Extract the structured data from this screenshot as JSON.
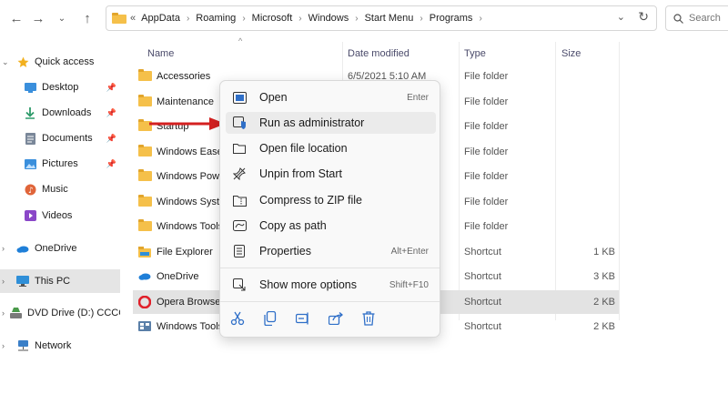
{
  "address": {
    "overflow": "«",
    "crumbs": [
      "AppData",
      "Roaming",
      "Microsoft",
      "Windows",
      "Start Menu",
      "Programs"
    ]
  },
  "search": {
    "placeholder": "Search"
  },
  "sidebar": {
    "items": [
      {
        "label": "Quick access",
        "icon": "star-icon",
        "color": "#f2b01e"
      },
      {
        "label": "Desktop",
        "icon": "desktop-icon",
        "color": "#3a8fdc"
      },
      {
        "label": "Downloads",
        "icon": "download-icon",
        "color": "#2e9a6a"
      },
      {
        "label": "Documents",
        "icon": "documents-icon",
        "color": "#7a8799"
      },
      {
        "label": "Pictures",
        "icon": "pictures-icon",
        "color": "#3a8fdc"
      },
      {
        "label": "Music",
        "icon": "music-icon",
        "color": "#e0653a"
      },
      {
        "label": "Videos",
        "icon": "videos-icon",
        "color": "#8a47c8"
      },
      {
        "label": "OneDrive",
        "icon": "onedrive-icon",
        "color": "#1f7fd8"
      },
      {
        "label": "This PC",
        "icon": "computer-icon",
        "color": "#2f8fd8"
      },
      {
        "label": "DVD Drive (D:) CCCO",
        "icon": "dvd-icon",
        "color": "#4a9a4a"
      },
      {
        "label": "Network",
        "icon": "network-icon",
        "color": "#3a7fc8"
      }
    ]
  },
  "columns": {
    "name": "Name",
    "date": "Date modified",
    "type": "Type",
    "size": "Size"
  },
  "files": [
    {
      "name": "Accessories",
      "date": "6/5/2021 5:10 AM",
      "type": "File folder",
      "size": "",
      "icon": "folder-icon"
    },
    {
      "name": "Maintenance",
      "date": "",
      "type": "File folder",
      "size": "",
      "icon": "folder-icon"
    },
    {
      "name": "Startup",
      "date": "",
      "type": "File folder",
      "size": "",
      "icon": "folder-icon"
    },
    {
      "name": "Windows Ease o",
      "date": "",
      "type": "File folder",
      "size": "",
      "icon": "folder-icon"
    },
    {
      "name": "Windows Powe",
      "date": "",
      "type": "File folder",
      "size": "",
      "icon": "folder-icon"
    },
    {
      "name": "Windows Syste",
      "date": "",
      "type": "File folder",
      "size": "",
      "icon": "folder-icon"
    },
    {
      "name": "Windows Tools",
      "date": "",
      "type": "File folder",
      "size": "",
      "icon": "folder-icon"
    },
    {
      "name": "File Explorer",
      "date": "",
      "type": "Shortcut",
      "size": "1 KB",
      "icon": "file-explorer-icon"
    },
    {
      "name": "OneDrive",
      "date": "",
      "type": "Shortcut",
      "size": "3 KB",
      "icon": "onedrive-icon"
    },
    {
      "name": "Opera Browser",
      "date": "",
      "type": "Shortcut",
      "size": "2 KB",
      "icon": "opera-icon"
    },
    {
      "name": "Windows Tools",
      "date": "",
      "type": "Shortcut",
      "size": "2 KB",
      "icon": "tools-icon"
    }
  ],
  "context_menu": {
    "items": [
      {
        "label": "Open",
        "shortcut": "Enter",
        "icon": "open-icon"
      },
      {
        "label": "Run as administrator",
        "shortcut": "",
        "icon": "shield-icon"
      },
      {
        "label": "Open file location",
        "shortcut": "",
        "icon": "folder-open-icon"
      },
      {
        "label": "Unpin from Start",
        "shortcut": "",
        "icon": "unpin-icon"
      },
      {
        "label": "Compress to ZIP file",
        "shortcut": "",
        "icon": "zip-icon"
      },
      {
        "label": "Copy as path",
        "shortcut": "",
        "icon": "copy-path-icon"
      },
      {
        "label": "Properties",
        "shortcut": "Alt+Enter",
        "icon": "properties-icon"
      },
      {
        "label": "Show more options",
        "shortcut": "Shift+F10",
        "icon": "more-options-icon"
      }
    ],
    "quick_actions": [
      "cut-icon",
      "copy-icon",
      "rename-icon",
      "share-icon",
      "delete-icon"
    ]
  },
  "colors": {
    "annotation_arrow": "#d42020",
    "selected_row": "#e3e3e3",
    "menu_hover": "#ebebeb"
  }
}
